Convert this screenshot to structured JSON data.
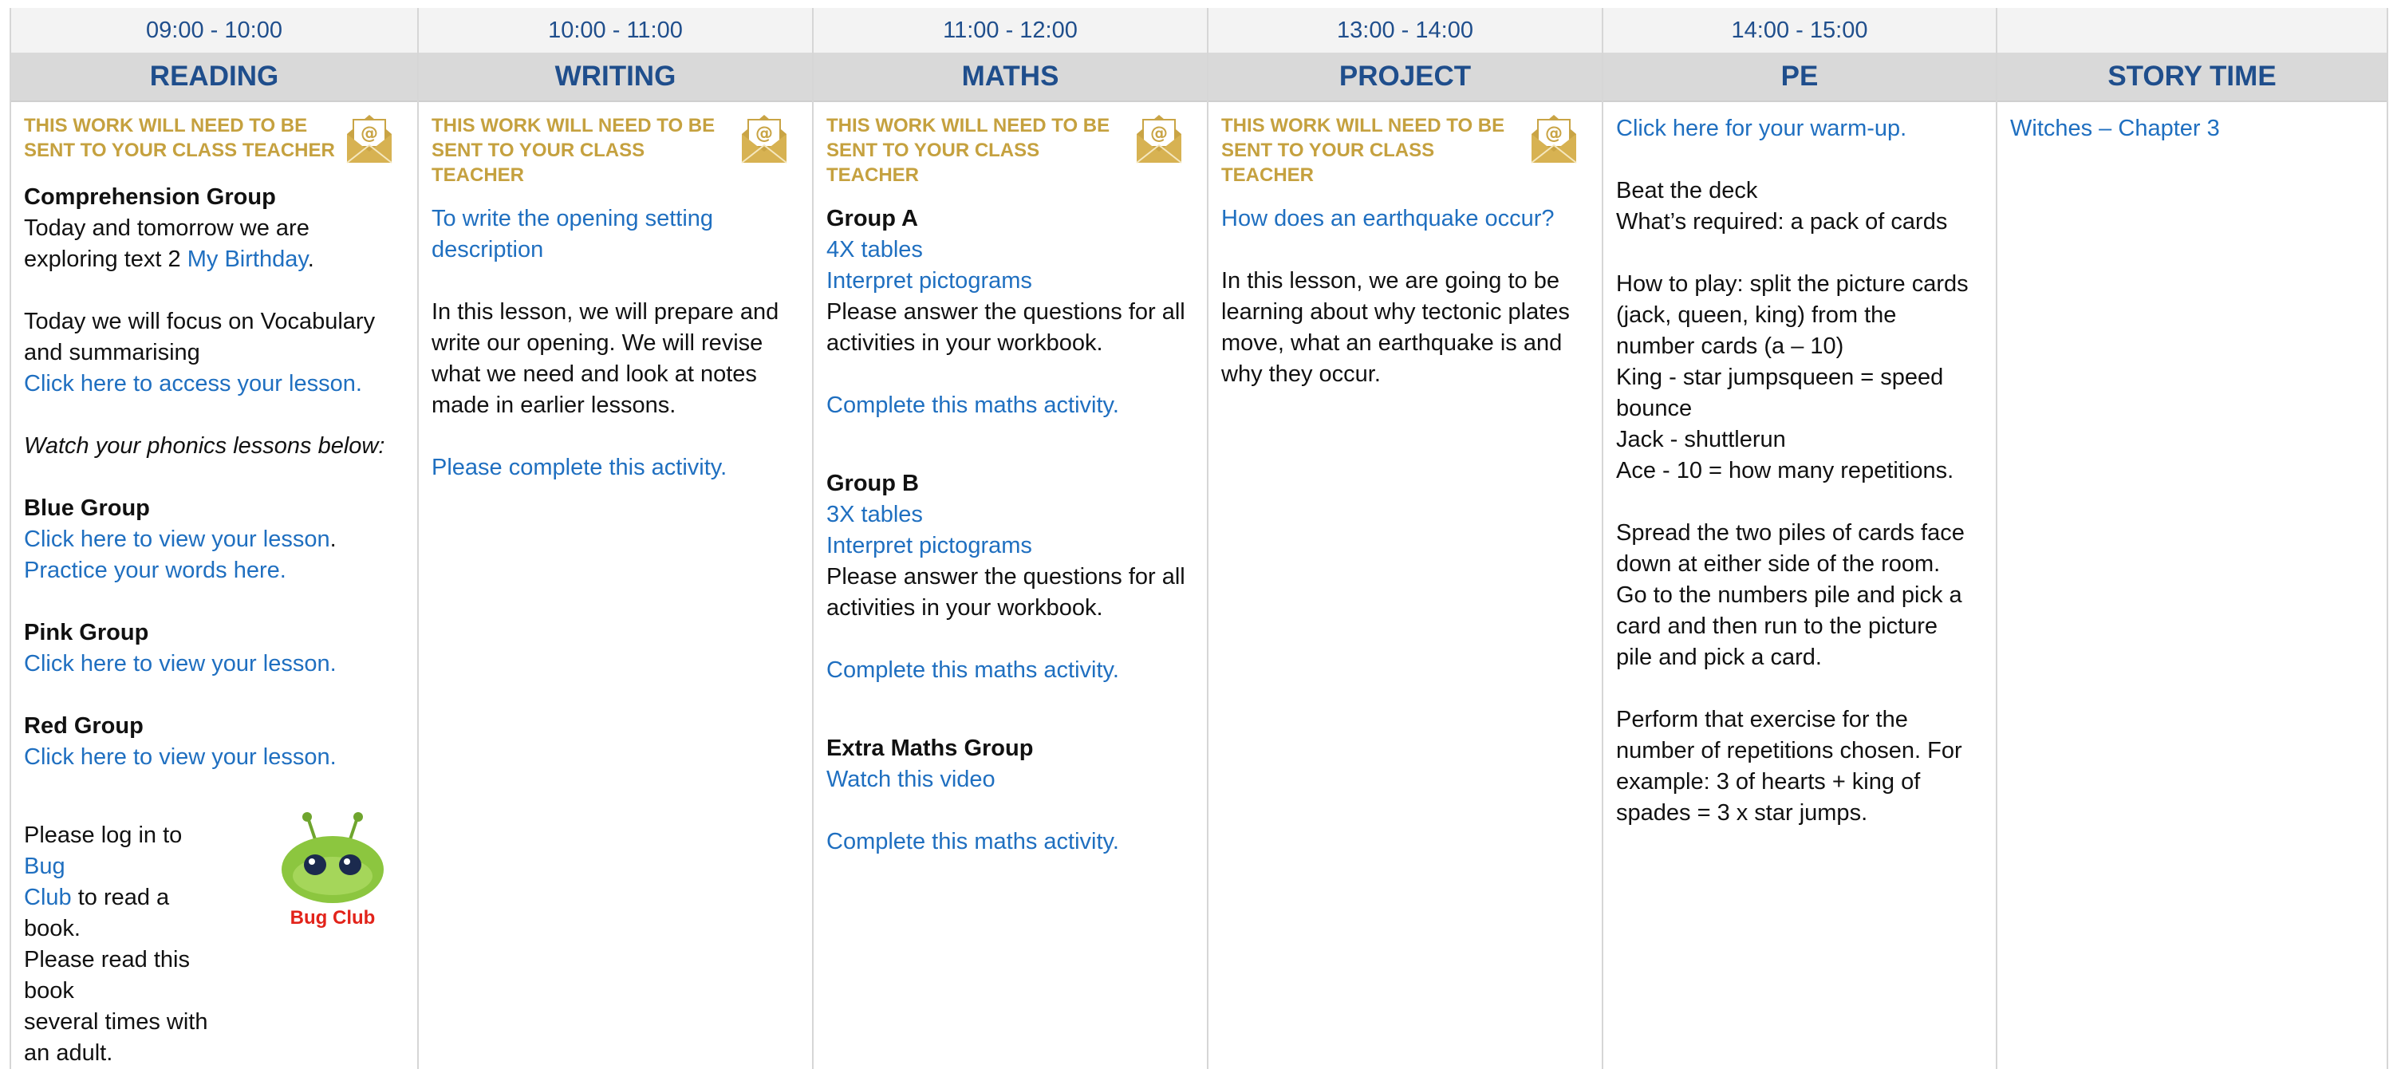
{
  "columns": [
    {
      "time": "09:00 - 10:00",
      "subject": "READING",
      "notice_line1": "THIS WORK WILL NEED TO BE",
      "notice_line2": "SENT TO YOUR CLASS TEACHER",
      "comp_heading": "Comprehension Group",
      "comp_line1": "Today and tomorrow we are",
      "comp_line2_pre": "exploring text 2 ",
      "comp_line2_link": "My Birthday",
      "comp_line2_post": ".",
      "focus_line1": "Today we will focus on Vocabulary",
      "focus_line2": "and summarising",
      "focus_link": "Click here to access your lesson.",
      "phonics": "Watch your phonics lessons below:",
      "blue_heading": "Blue Group",
      "blue_link1": "Click here to view your lesson",
      "blue_link1_post": ".",
      "blue_link2": "Practice your words here.",
      "pink_heading": "Pink Group",
      "pink_link": "Click here to view your lesson.",
      "red_heading": "Red Group",
      "red_link": "Click here to view your lesson.",
      "bug_pre": "Please log in to ",
      "bug_link1": "Bug",
      "bug_link2": "Club",
      "bug_post": " to read a book.",
      "bug_line3": "Please read this book",
      "bug_line4": "several times with",
      "bug_line5": "an adult.",
      "bug_logo": "Bug Club"
    },
    {
      "time": "10:00 - 11:00",
      "subject": "WRITING",
      "notice_line1": "THIS WORK WILL NEED TO BE",
      "notice_line2": "SENT TO YOUR CLASS TEACHER",
      "link1_line1": "To write the opening setting",
      "link1_line2": "description",
      "para_line1": "In this lesson, we will prepare and",
      "para_line2": "write our opening. We will revise",
      "para_line3": "what we need and look at notes",
      "para_line4": "made in earlier lessons.",
      "activity_link": "Please complete this activity."
    },
    {
      "time": "11:00 - 12:00",
      "subject": "MATHS",
      "notice_line1": "THIS WORK WILL NEED TO BE",
      "notice_line2": "SENT TO YOUR CLASS TEACHER",
      "groupA_heading": "Group A",
      "groupA_link1": "4X tables",
      "groupA_link2": "Interpret pictograms",
      "groupA_text1": "Please answer the questions for all",
      "groupA_text2": "activities in your workbook.",
      "groupA_activity": "Complete this maths activity.",
      "groupB_heading": "Group B",
      "groupB_link1": "3X tables",
      "groupB_link2": "Interpret pictograms",
      "groupB_text1": "Please answer the questions for all",
      "groupB_text2": "activities in your workbook.",
      "groupB_activity": "Complete this maths activity.",
      "extra_heading": "Extra Maths Group",
      "extra_link": "Watch this video",
      "extra_activity": "Complete this maths activity."
    },
    {
      "time": "13:00 - 14:00",
      "subject": "PROJECT",
      "notice_line1": "THIS WORK WILL NEED TO BE",
      "notice_line2": "SENT TO YOUR CLASS TEACHER",
      "link": "How does an earthquake occur?",
      "para_line1": "In this lesson, we are going to be",
      "para_line2": "learning about why tectonic plates",
      "para_line3": "move, what an earthquake is and",
      "para_line4": "why they occur."
    },
    {
      "time": "14:00 - 15:00",
      "subject": "PE",
      "warmup_link": "Click here for your warm-up.",
      "beat": "Beat the deck",
      "required": "What’s required: a pack of cards",
      "how_line1": "How to play: split the picture cards",
      "how_line2": "(jack, queen, king) from the",
      "how_line3": "number cards (a – 10)",
      "how_line4": "King - star jumpsqueen = speed",
      "how_line5": "bounce",
      "how_line6": "Jack - shuttlerun",
      "how_line7": "Ace - 10 = how many repetitions.",
      "spread_line1": "Spread the two piles of cards face",
      "spread_line2": "down at either side of the room.",
      "spread_line3": "Go to the numbers pile and pick a",
      "spread_line4": "card and then run to the picture",
      "spread_line5": "pile and pick a card.",
      "perf_line1": "Perform that exercise for the",
      "perf_line2": "number of repetitions chosen. For",
      "perf_line3": "example: 3 of hearts + king of",
      "perf_line4": "spades = 3 x star jumps."
    },
    {
      "time": "",
      "subject": "STORY TIME",
      "story_link": "Witches – Chapter 3"
    }
  ],
  "colors": {
    "link": "#1f6fc0",
    "header_text": "#1f4e8c",
    "notice": "#c5a13f",
    "bug_green": "#8cc63f",
    "bug_red": "#e2231a"
  },
  "icons": {
    "envelope": "email-envelope-icon",
    "bug": "bug-club-logo"
  }
}
